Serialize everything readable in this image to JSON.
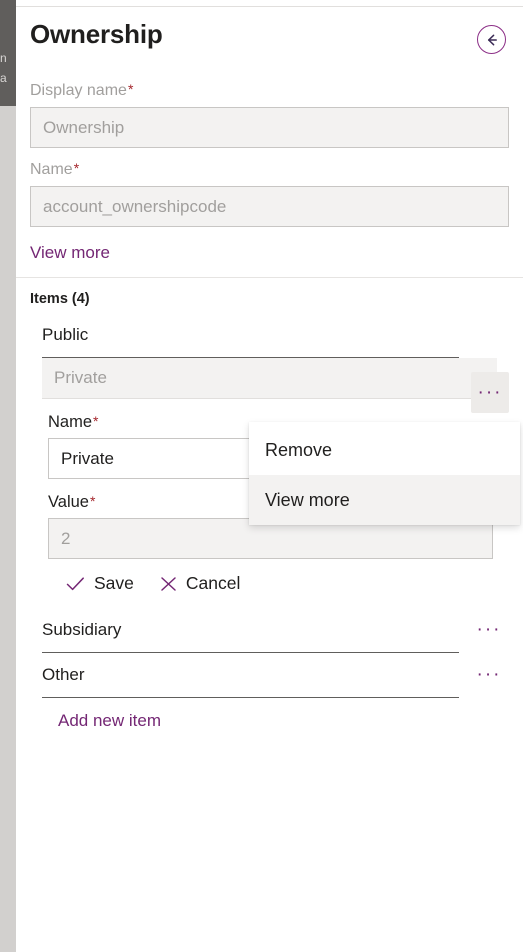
{
  "background": {
    "ghost_line_1": "n",
    "ghost_line_2": "a"
  },
  "header": {
    "title": "Ownership",
    "back_button_icon": "back-arrow-icon"
  },
  "upper_form": {
    "display_name": {
      "label": "Display name",
      "required_marker": "*",
      "value": "Ownership"
    },
    "name": {
      "label": "Name",
      "required_marker": "*",
      "value": "account_ownershipcode"
    },
    "view_more_link": "View more"
  },
  "items_section": {
    "heading": "Items (4)",
    "rows": [
      {
        "label": "Public",
        "ellipsis": "···"
      },
      {
        "label": "Private",
        "ellipsis": "···"
      },
      {
        "label": "Subsidiary",
        "ellipsis": "···"
      },
      {
        "label": "Other",
        "ellipsis": "···"
      }
    ],
    "add_new_item_link": "Add new item"
  },
  "inline_edit_form": {
    "name": {
      "label": "Name",
      "required_marker": "*",
      "value": "Private"
    },
    "value": {
      "label": "Value",
      "required_marker": "*",
      "value": "2"
    },
    "save_label": "Save",
    "cancel_label": "Cancel",
    "save_icon": "checkmark-icon",
    "cancel_icon": "cross-icon"
  },
  "context_menu": {
    "items": [
      {
        "label": "Remove",
        "highlighted": false
      },
      {
        "label": "View more",
        "highlighted": true
      }
    ]
  },
  "colors": {
    "accent_purple": "#742774",
    "required_red": "#a4262c",
    "text_primary": "#201f1e",
    "text_secondary": "#a19f9d",
    "disabled_field_bg": "#f3f2f1"
  }
}
